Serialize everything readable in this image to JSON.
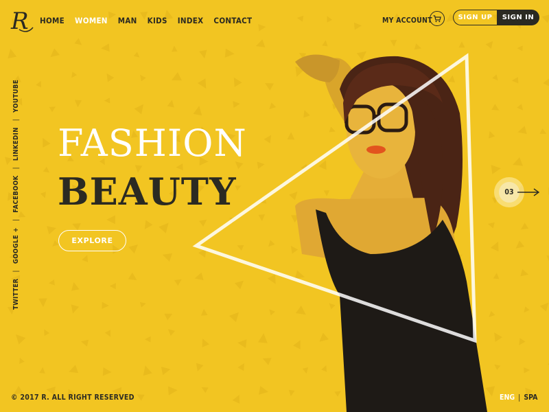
{
  "brand": {
    "logo_letter": "R"
  },
  "nav": {
    "items": [
      {
        "label": "HOME",
        "active": false
      },
      {
        "label": "WOMEN",
        "active": true
      },
      {
        "label": "MAN",
        "active": false
      },
      {
        "label": "KIDS",
        "active": false
      },
      {
        "label": "INDEX",
        "active": false
      },
      {
        "label": "CONTACT",
        "active": false
      }
    ]
  },
  "header": {
    "account_label": "MY ACCOUNT",
    "signup_label": "SIGN UP",
    "signin_label": "SIGN IN",
    "cart_icon": "cart-icon"
  },
  "social": {
    "links": [
      "TWITTER",
      "GOOGLE +",
      "FACEBOOK",
      "LINKEDIN",
      "YOUTUBE"
    ],
    "separator": "|"
  },
  "hero": {
    "title": "FASHION",
    "subtitle": "BEAUTY",
    "button_label": "EXPLORE"
  },
  "slider": {
    "current": "03",
    "arrow_icon": "arrow-right-icon"
  },
  "footer": {
    "copyright": "© 2017 R. ALL RIGHT RESERVED",
    "lang_active": "ENG",
    "lang_separator": "|",
    "lang_other": "SPA"
  },
  "colors": {
    "background": "#f2c522",
    "dark": "#2b2a22",
    "light": "#ffffff"
  }
}
